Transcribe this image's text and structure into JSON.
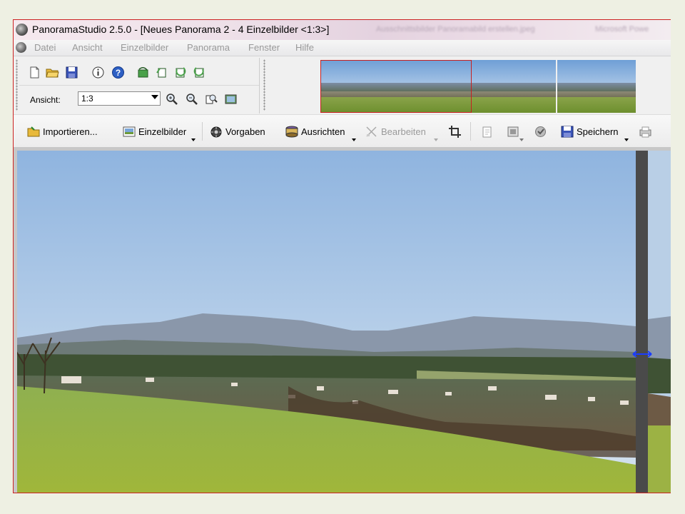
{
  "window": {
    "title": "PanoramaStudio 2.5.0 - [Neues Panorama 2 - 4 Einzelbilder <1:3>]",
    "ghost_text_1": "Ausschnittsbilder Panoramabild erstellen.jpeg",
    "ghost_text_2": "Microsoft Powe",
    "app_icon": "panoramastudio-icon"
  },
  "menu": {
    "items": [
      "Datei",
      "Ansicht",
      "Einzelbilder",
      "Panorama",
      "Fenster",
      "Hilfe"
    ]
  },
  "view": {
    "label": "Ansicht:",
    "zoom_value": "1:3"
  },
  "thumbnails": {
    "count": 4,
    "selected_range": "1-2",
    "selection_color": "#c82020"
  },
  "toolbar": {
    "import_label": "Importieren...",
    "einzelbilder_label": "Einzelbilder",
    "vorgaben_label": "Vorgaben",
    "ausrichten_label": "Ausrichten",
    "bearbeiten_label": "Bearbeiten",
    "speichern_label": "Speichern"
  },
  "icons": {
    "top_row": [
      "new-document-icon",
      "open-folder-icon",
      "save-icon",
      "info-icon",
      "help-icon",
      "rotate-left-icon",
      "rotate-right-icon",
      "rotate-cw-icon",
      "rotate-ccw-icon"
    ],
    "view_row": [
      "zoom-in-icon",
      "zoom-out-icon",
      "zoom-fit-icon",
      "fullscreen-icon"
    ],
    "toolbar_right": [
      "crop-icon",
      "stitch-icon",
      "export-icon",
      "settings-icon",
      "print-icon"
    ]
  },
  "colors": {
    "window_border": "#cc2222",
    "divider": "#4a4a4a",
    "handle": "#1a3cff"
  }
}
